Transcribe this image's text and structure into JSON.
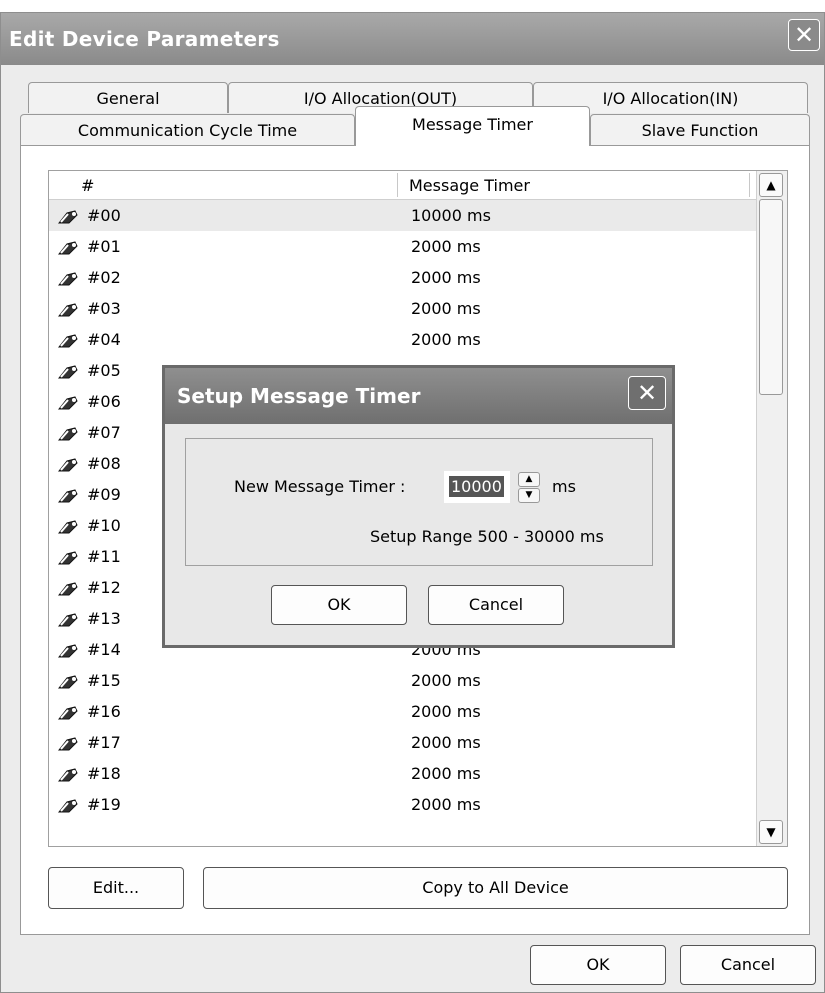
{
  "window": {
    "title": "Edit Device Parameters"
  },
  "tabs": {
    "row1": [
      "General",
      "I/O Allocation(OUT)",
      "I/O Allocation(IN)"
    ],
    "row2": [
      "Communication Cycle Time",
      "Message Timer",
      "Slave Function"
    ],
    "active": "Message Timer"
  },
  "list": {
    "columns": [
      "#",
      "Message Timer"
    ],
    "rows": [
      {
        "id": "#00",
        "value": "10000 ms"
      },
      {
        "id": "#01",
        "value": "2000 ms"
      },
      {
        "id": "#02",
        "value": "2000 ms"
      },
      {
        "id": "#03",
        "value": "2000 ms"
      },
      {
        "id": "#04",
        "value": "2000 ms"
      },
      {
        "id": "#05",
        "value": ""
      },
      {
        "id": "#06",
        "value": ""
      },
      {
        "id": "#07",
        "value": ""
      },
      {
        "id": "#08",
        "value": ""
      },
      {
        "id": "#09",
        "value": ""
      },
      {
        "id": "#10",
        "value": ""
      },
      {
        "id": "#11",
        "value": ""
      },
      {
        "id": "#12",
        "value": ""
      },
      {
        "id": "#13",
        "value": ""
      },
      {
        "id": "#14",
        "value": "2000 ms"
      },
      {
        "id": "#15",
        "value": "2000 ms"
      },
      {
        "id": "#16",
        "value": "2000 ms"
      },
      {
        "id": "#17",
        "value": "2000 ms"
      },
      {
        "id": "#18",
        "value": "2000 ms"
      },
      {
        "id": "#19",
        "value": "2000 ms"
      }
    ],
    "selected_index": 0
  },
  "panel_buttons": {
    "edit": "Edit...",
    "copy": "Copy to All Device"
  },
  "footer": {
    "ok": "OK",
    "cancel": "Cancel"
  },
  "dialog": {
    "title": "Setup Message Timer",
    "field_label": "New Message Timer :",
    "field_value": "10000",
    "unit": "ms",
    "range_text": "Setup Range 500 - 30000 ms",
    "ok": "OK",
    "cancel": "Cancel"
  }
}
